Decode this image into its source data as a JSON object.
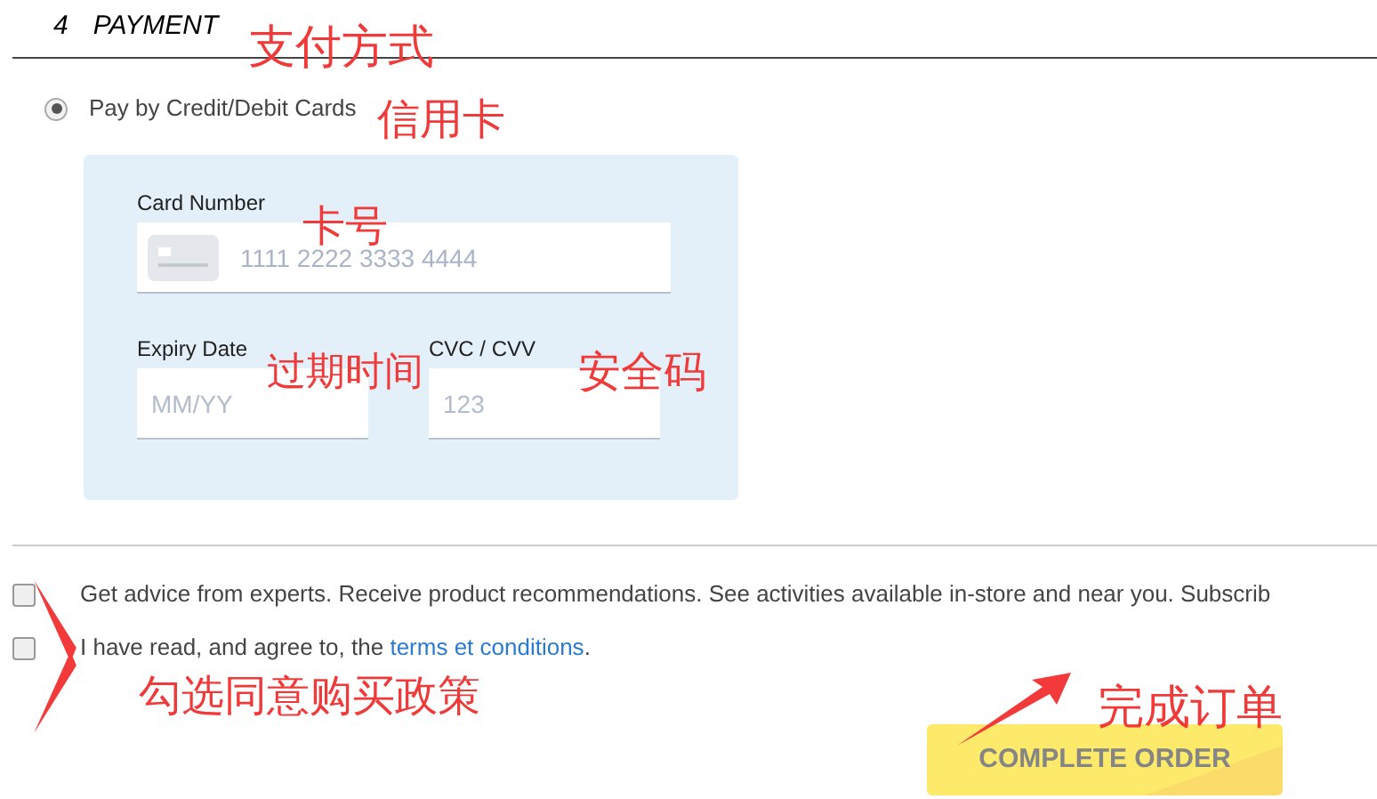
{
  "section": {
    "number": "4",
    "title": "PAYMENT"
  },
  "payment_methods": [
    {
      "label": "Pay by Credit/Debit Cards",
      "selected": true
    }
  ],
  "card_form": {
    "card_number": {
      "label": "Card Number",
      "placeholder": "1111 2222 3333 4444"
    },
    "expiry": {
      "label": "Expiry Date",
      "placeholder": "MM/YY"
    },
    "cvc": {
      "label": "CVC / CVV",
      "placeholder": "123"
    }
  },
  "consents": [
    {
      "text": "Get advice from experts. Receive product recommendations. See activities available in-store and near you. Subscrib",
      "checked": false
    },
    {
      "text": "I have read, and agree to, the",
      "link": "terms et conditions",
      "after": ".",
      "checked": false
    }
  ],
  "submit_button": "COMPLETE ORDER",
  "annotations": [
    "支付方式",
    "信用卡",
    "卡号",
    "过期时间",
    "安全码",
    "勾选同意购买政策",
    "完成订单"
  ]
}
